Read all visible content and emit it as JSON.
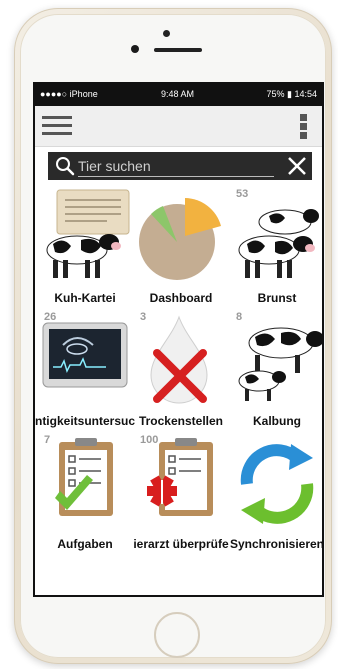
{
  "status_bar": {
    "carrier": "●●●●○ iPhone",
    "time": "9:48 AM",
    "battery": "75% ▮ 14:54"
  },
  "search": {
    "placeholder": "Tier suchen",
    "value": ""
  },
  "tiles": [
    {
      "label": "Kuh-Kartei",
      "count": ""
    },
    {
      "label": "Dashboard",
      "count": ""
    },
    {
      "label": "Brunst",
      "count": "53"
    },
    {
      "label": "ntigkeitsuntersuc",
      "count": "26"
    },
    {
      "label": "Trockenstellen",
      "count": "3"
    },
    {
      "label": "Kalbung",
      "count": "8"
    },
    {
      "label": "Aufgaben",
      "count": "7"
    },
    {
      "label": "ierarzt überprüfe",
      "count": "100"
    },
    {
      "label": "Synchronisieren",
      "count": ""
    }
  ],
  "colors": {
    "toolbar_bg": "#efefef",
    "search_bg": "#2a2a2a",
    "count_text": "#9a9a9a"
  },
  "icons": {
    "menu": "hamburger-icon",
    "more": "vertical-dots-icon",
    "search": "search-icon",
    "clear": "close-icon"
  }
}
